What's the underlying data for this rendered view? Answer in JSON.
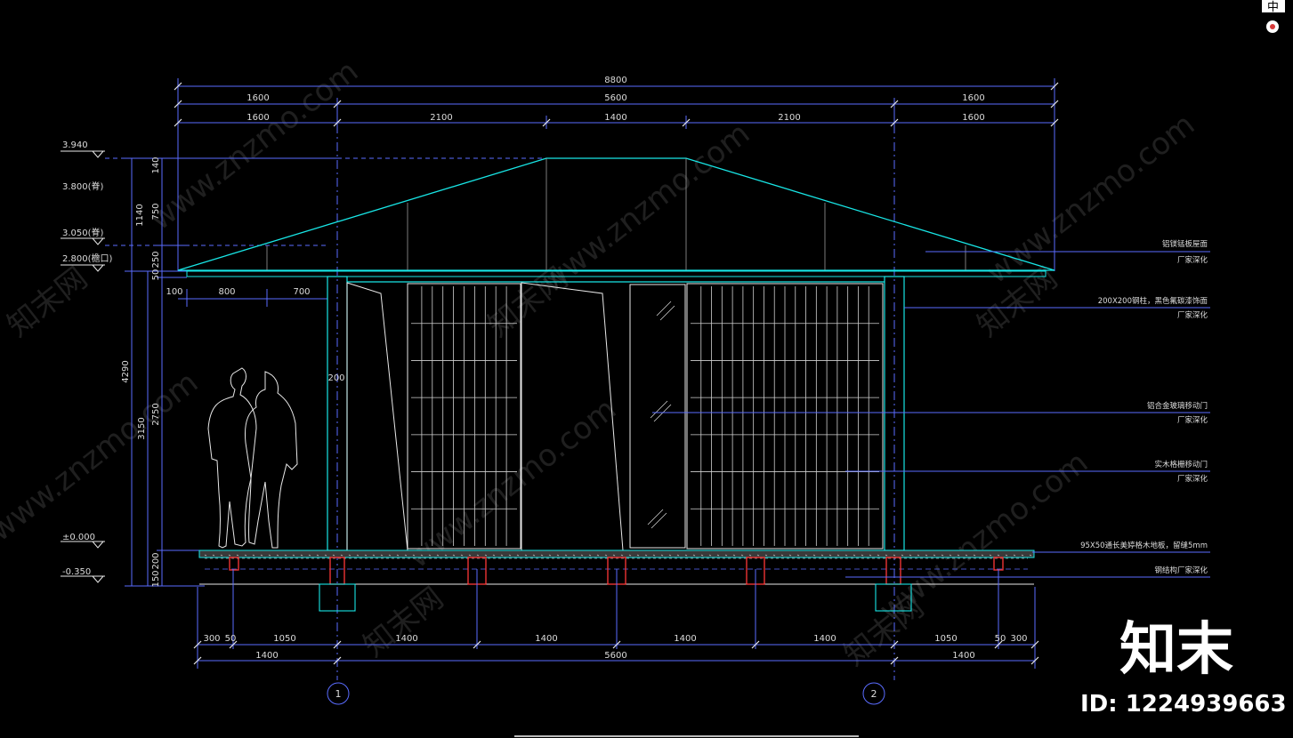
{
  "drawing": {
    "top_dims": {
      "overall": "8800",
      "row2": [
        "1600",
        "5600",
        "1600"
      ],
      "row3": [
        "1600",
        "2100",
        "1400",
        "2100",
        "1600"
      ]
    },
    "eave_dims": [
      "100",
      "800",
      "700"
    ],
    "post_dim": "200",
    "left_levels": [
      "3.940",
      "3.800(脊)",
      "3.050(脊)",
      "2.800(檐口)",
      "±0.000",
      "-0.350"
    ],
    "left_dims_outer": [
      "4290"
    ],
    "left_dims_mid": [
      "3150"
    ],
    "left_dims_inner": [
      "140",
      "1140",
      "750",
      "250",
      "50",
      "2750",
      "200",
      "150"
    ],
    "notes": [
      {
        "line1": "铝镁锰板屋面",
        "line2": "厂家深化"
      },
      {
        "line1": "200X200钢柱，黑色氟碳漆饰面",
        "line2": "厂家深化"
      },
      {
        "line1": "铝合金玻璃移动门",
        "line2": "厂家深化"
      },
      {
        "line1": "实木格栅移动门",
        "line2": "厂家深化"
      },
      {
        "line1": "95X50通长美婷格木地板，留缝5mm",
        "line2": ""
      },
      {
        "line1": "钢结构厂家深化",
        "line2": ""
      }
    ],
    "bottom_dims": {
      "row1": [
        "300",
        "50",
        "1050",
        "1400",
        "1400",
        "1400",
        "1400",
        "1050",
        "50",
        "300"
      ],
      "row2": [
        "1400",
        "5600",
        "1400"
      ]
    },
    "axes": [
      "1",
      "2"
    ],
    "watermark": [
      "www.znzmo.com",
      "知末网"
    ]
  },
  "brand": {
    "logo": "知末",
    "id_label": "ID: 1224939663"
  },
  "toolbar": {
    "ime_label": "中"
  },
  "colors": {
    "cyan": "#18e6e6",
    "dim_blue": "#5a6cff",
    "white": "#e8e8e8",
    "red": "#ff3838",
    "gray": "#9a9a9a"
  }
}
